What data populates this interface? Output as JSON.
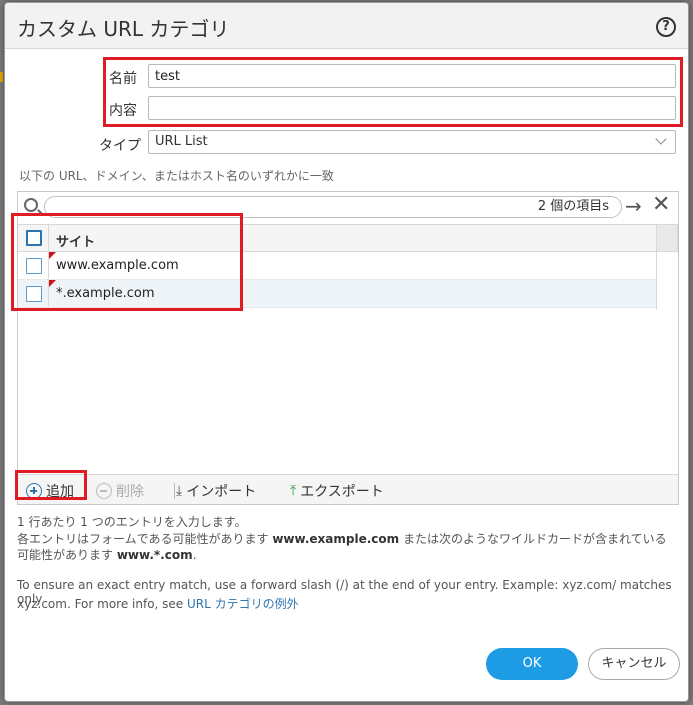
{
  "dialog": {
    "title": "カスタム URL カテゴリ",
    "help_icon": "?"
  },
  "form": {
    "name_label": "名前",
    "name_value": "test",
    "description_label": "内容",
    "description_value": "",
    "type_label": "タイプ",
    "type_value": "URL List"
  },
  "hint": "以下の URL、ドメイン、またはホスト名のいずれかに一致",
  "grid": {
    "search_count": "2 個の項目s",
    "arrow": "→",
    "close": "✕",
    "column_header": "サイト",
    "rows": [
      {
        "site": "www.example.com"
      },
      {
        "site": "*.example.com"
      }
    ]
  },
  "toolbar": {
    "add": "追加",
    "delete": "削除",
    "import": "インポート",
    "export": "エクスポート"
  },
  "info": {
    "line1": "1 行あたり 1 つのエントリを入力します。",
    "line2_a": "各エントリはフォームである可能性があります ",
    "line2_b": "www.example.com",
    "line2_c": " または次のようなワイルドカードが含まれている",
    "line3_a": "可能性があります ",
    "line3_b": "www.*.com",
    "line3_c": ".",
    "line4": "To ensure an exact entry match, use a forward slash (/) at the end of your entry. Example: xyz.com/ matches only",
    "line5_a": "xyz.com. For more info, see ",
    "line5_link": "URL カテゴリの例外"
  },
  "buttons": {
    "ok": "OK",
    "cancel": "キャンセル"
  },
  "colors": {
    "highlight": "#e01b24",
    "primary": "#1e9be5",
    "link": "#2e75b0"
  }
}
